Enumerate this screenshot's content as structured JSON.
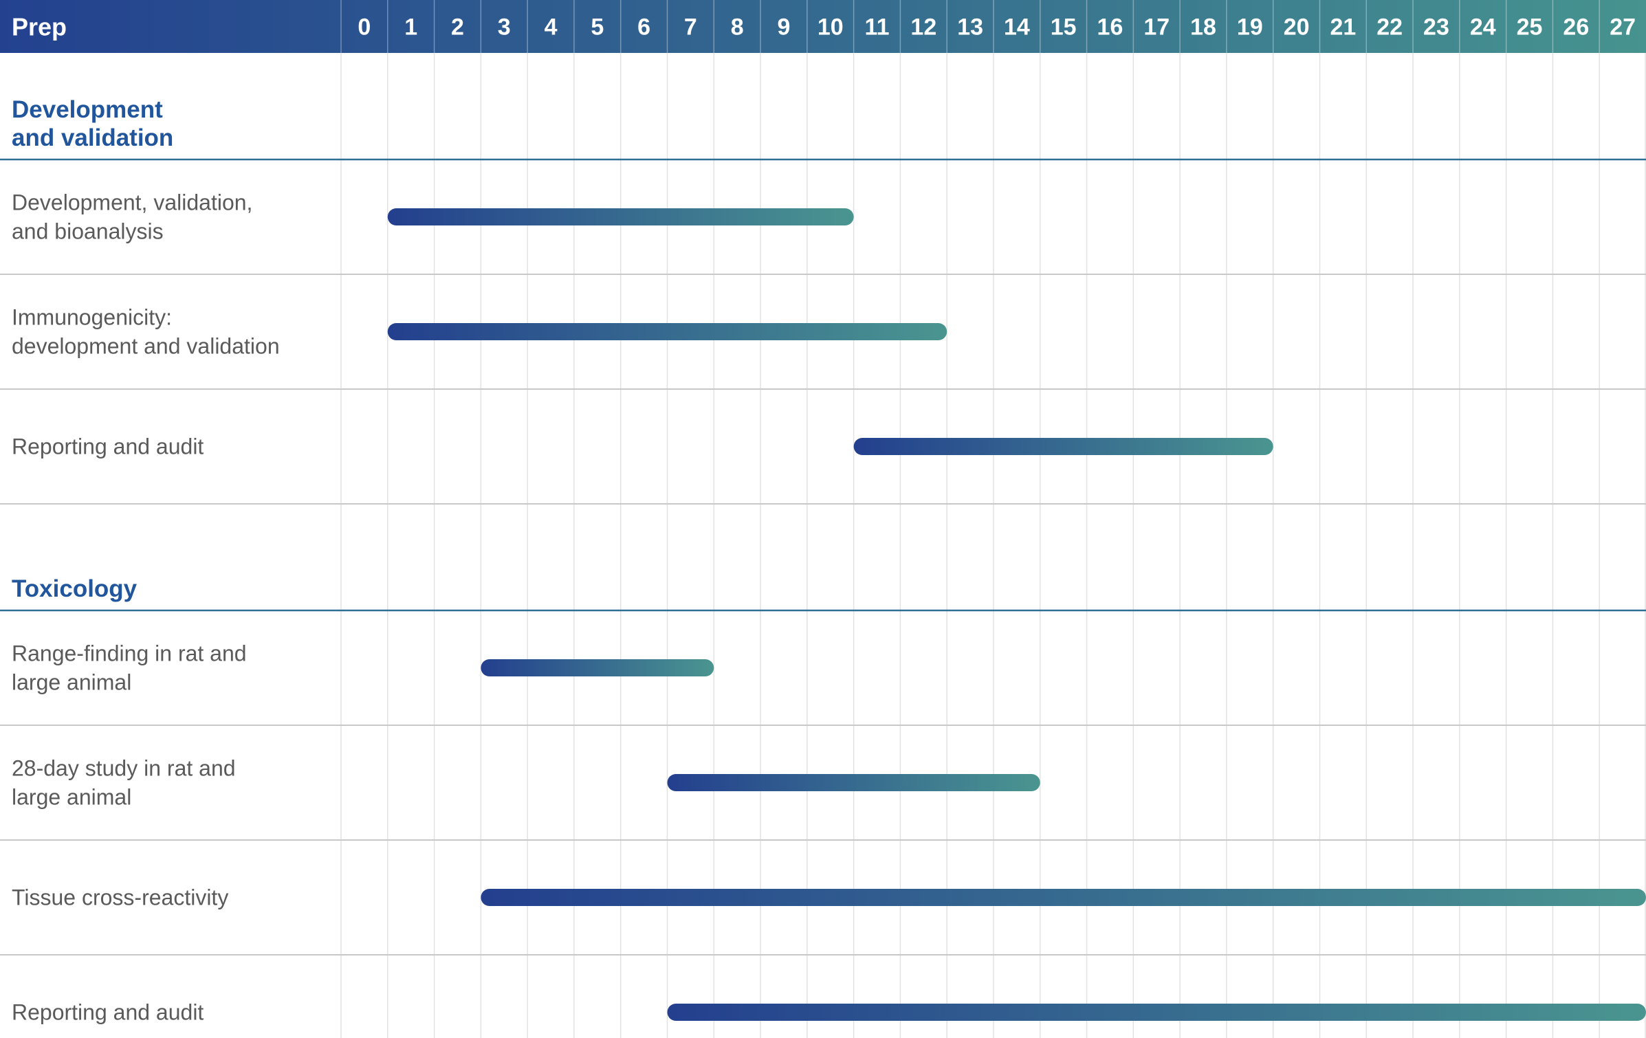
{
  "chart_data": {
    "type": "gantt",
    "header": {
      "first_column_label": "Prep"
    },
    "x_ticks": [
      "0",
      "1",
      "2",
      "3",
      "4",
      "5",
      "6",
      "7",
      "8",
      "9",
      "10",
      "11",
      "12",
      "13",
      "14",
      "15",
      "16",
      "17",
      "18",
      "19",
      "20",
      "21",
      "22",
      "23",
      "24",
      "25",
      "26",
      "27"
    ],
    "x_range": [
      0,
      28
    ],
    "colors": {
      "header_start": "#23418f",
      "header_end": "#46938f",
      "bar_start": "#233f8e",
      "bar_end": "#4a9590",
      "section_title": "#22569c",
      "section_rule": "#2f6f96",
      "row_rule": "#c8c8c8",
      "grid": "#e2e2e2",
      "task_text": "#5a5a5a"
    },
    "sections": [
      {
        "title_lines": [
          "Development",
          "and validation"
        ],
        "tasks": [
          {
            "label_lines": [
              "Development, validation,",
              "and bioanalysis"
            ],
            "start": 1,
            "end": 11
          },
          {
            "label_lines": [
              "Immunogenicity:",
              "development and validation"
            ],
            "start": 1,
            "end": 13
          },
          {
            "label_lines": [
              "Reporting and audit"
            ],
            "start": 11,
            "end": 20
          }
        ]
      },
      {
        "title_lines": [
          "Toxicology"
        ],
        "tasks": [
          {
            "label_lines": [
              "Range-finding in rat and",
              "large animal"
            ],
            "start": 3,
            "end": 8
          },
          {
            "label_lines": [
              "28-day study in rat and",
              "large animal"
            ],
            "start": 7,
            "end": 15
          },
          {
            "label_lines": [
              "Tissue cross-reactivity"
            ],
            "start": 3,
            "end": 28
          },
          {
            "label_lines": [
              "Reporting and audit"
            ],
            "start": 7,
            "end": 28
          }
        ]
      }
    ]
  }
}
